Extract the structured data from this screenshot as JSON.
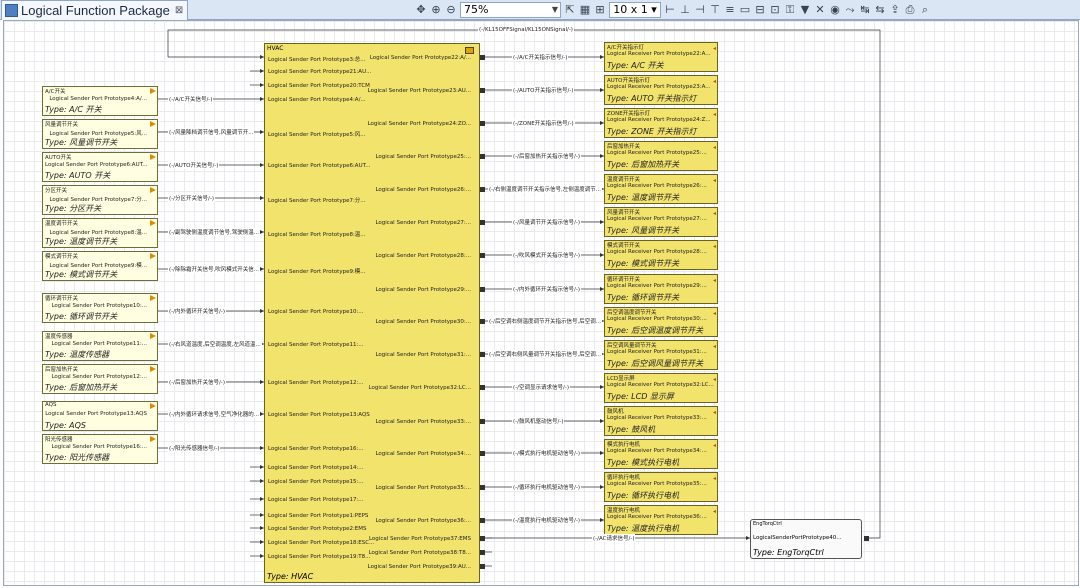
{
  "window": {
    "tab_title": "Logical Function Package"
  },
  "toolbar": {
    "zoom_value": "75%",
    "grid_value": "10 x 1"
  },
  "top_signal": "(-/KL15OFFSignal/KL15ONSignal/-)",
  "hvac": {
    "name": "HVAC",
    "type": "Type: HVAC",
    "left_ports": [
      "Logical Sender Port Prototype3:总...",
      "Logical Sender Port Prototype21:AU...",
      "Logical Sender Port Prototype20:TCM",
      "Logical Sender Port Prototype4:A/...",
      "Logical Sender Port Prototype5:风...",
      "Logical Sender Port Prototype6:AUT...",
      "Logical Sender Port Prototype7:分...",
      "Logical Sender Port Prototype8:温...",
      "Logical Sender Port Prototype9:模...",
      "Logical Sender Port Prototype10:...",
      "Logical Sender Port Prototype11:...",
      "Logical Sender Port Prototype12:...",
      "Logical Sender Port Prototype13:AQS",
      "Logical Sender Port Prototype16:...",
      "Logical Sender Port Prototype14:...",
      "Logical Sender Port Prototype15:...",
      "Logical Sender Port Prototype17:...",
      "Logical Sender Port Prototype1:PEPS",
      "Logical Sender Port Prototype2:EMS",
      "Logical Sender Port Prototype18:ESC...",
      "Logical Sender Port Prototype19:T8..."
    ],
    "right_ports": [
      "Logical Sender Port Prototype22:A/...",
      "Logical Sender Port Prototype23:AU...",
      "Logical Sender Port Prototype24:ZO...",
      "Logical Sender Port Prototype25:...",
      "Logical Sender Port Prototype26:...",
      "Logical Sender Port Prototype27:...",
      "Logical Sender Port Prototype28:...",
      "Logical Sender Port Prototype29:...",
      "Logical Sender Port Prototype30:...",
      "Logical Sender Port Prototype31:...",
      "Logical Sender Port Prototype32:LC...",
      "Logical Sender Port Prototype33:...",
      "Logical Sender Port Prototype34:...",
      "Logical Sender Port Prototype35:...",
      "Logical Sender Port Prototype36:...",
      "Logical Sender Port Prototype37:EMS",
      "Logical Sender Port Prototype38:T8...",
      "Logical Sender Port Prototype39:AU..."
    ]
  },
  "senders": [
    {
      "name": "A/C开关",
      "port": "Logical Sender Port Prototype4:A/...",
      "type": "Type: A/C 开关",
      "signal": "(-/A/C开关信号/-)"
    },
    {
      "name": "风量调节开关",
      "port": "Logical Sender Port Prototype5:风...",
      "type": "Type: 风量调节开关",
      "signal": "(-/风量降档调节信号,风量调节开..."
    },
    {
      "name": "AUTO开关",
      "port": "Logical Sender Port Prototype6:AUT...",
      "type": "Type: AUTO 开关",
      "signal": "(-/AUTO开关信号/-)"
    },
    {
      "name": "分区开关",
      "port": "Logical Sender Port Prototype7:分...",
      "type": "Type: 分区开关",
      "signal": "(-/分区开关信号/-)"
    },
    {
      "name": "温度调节开关",
      "port": "Logical Sender Port Prototype8:温...",
      "type": "Type: 温度调节开关",
      "signal": "(-/副驾驶侧温度调节信号,驾驶侧温..."
    },
    {
      "name": "模式调节开关",
      "port": "Logical Sender Port Prototype9:模...",
      "type": "Type: 模式调节开关",
      "signal": "(-/除除霜开关信号,吹风模式开关信..."
    },
    {
      "name": "循环调节开关",
      "port": "Logical Sender Port Prototype10:...",
      "type": "Type: 循环调节开关",
      "signal": "(-/内外循环开关信号/-)"
    },
    {
      "name": "温度传感器",
      "port": "Logical Sender Port Prototype11:...",
      "type": "Type: 温度传感器",
      "signal": "(-/右风道温度,后空调温度,左风道温..."
    },
    {
      "name": "后窗加热开关",
      "port": "Logical Sender Port Prototype12:...",
      "type": "Type: 后窗加热开关",
      "signal": "(-/后窗加热开关信号/-)"
    },
    {
      "name": "AQS",
      "port": "Logical Sender Port Prototype13:AQS",
      "type": "Type: AQS",
      "signal": "(-/内外循环请求信号,空气净化器的..."
    },
    {
      "name": "阳光传感器",
      "port": "Logical Sender Port Prototype16:...",
      "type": "Type: 阳光传感器",
      "signal": "(-/阳光传感器信号/-)"
    }
  ],
  "receivers": [
    {
      "name": "A/C开关指示灯",
      "port": "Logical Receiver Port Prototype22:A...",
      "type": "Type: A/C 开关",
      "signal": "(-/A/C开关指示信号/-)"
    },
    {
      "name": "AUTO开关指示灯",
      "port": "Logical Receiver Port Prototype23:A...",
      "type": "Type: AUTO 开关指示灯",
      "signal": "(-/AUTO开关指示信号/-)"
    },
    {
      "name": "ZONE开关指示灯",
      "port": "Logical Receiver Port Prototype24:Z...",
      "type": "Type: ZONE 开关指示灯",
      "signal": "(-/ZONE开关指示信号/-)"
    },
    {
      "name": "后窗加热开关",
      "port": "Logical Receiver Port Prototype25:...",
      "type": "Type: 后窗加热开关",
      "signal": "(-/后窗加热开关指示信号/-)"
    },
    {
      "name": "温度调节开关",
      "port": "Logical Receiver Port Prototype26:...",
      "type": "Type: 温度调节开关",
      "signal": "(-/右侧温度调节开关指示信号,左侧温度调节..."
    },
    {
      "name": "风量调节开关",
      "port": "Logical Receiver Port Prototype27:...",
      "type": "Type: 风量调节开关",
      "signal": "(-/风量调节开关指示信号/-)"
    },
    {
      "name": "模式调节开关",
      "port": "Logical Receiver Port Prototype28:...",
      "type": "Type: 模式调节开关",
      "signal": "(-/吹风模式开关指示信号/-)"
    },
    {
      "name": "循环调节开关",
      "port": "Logical Receiver Port Prototype29:...",
      "type": "Type: 循环调节开关",
      "signal": "(-/内外循环开关指示信号/-)"
    },
    {
      "name": "后空调温度调节开关",
      "port": "Logical Receiver Port Prototype30:...",
      "type": "Type: 后空调温度调节开关",
      "signal": "(-/后空调右侧温度调节开关指示信号,后空调..."
    },
    {
      "name": "后空调风量调节开关",
      "port": "Logical Receiver Port Prototype31:...",
      "type": "Type: 后空调风量调节开关",
      "signal": "(-/后空调右侧风量调节开关指示信号,后空调..."
    },
    {
      "name": "LCD显示屏",
      "port": "Logical Receiver Port Prototype32:LC...",
      "type": "Type: LCD 显示屏",
      "signal": "(-/空调显示请求信号/-)"
    },
    {
      "name": "鼓风机",
      "port": "Logical Receiver Port Prototype33:...",
      "type": "Type: 鼓风机",
      "signal": "(-/鼓风机驱动信号/-)"
    },
    {
      "name": "模式执行电机",
      "port": "Logical Receiver Port Prototype34:...",
      "type": "Type: 模式执行电机",
      "signal": "(-/模式执行电机驱动信号/-)"
    },
    {
      "name": "循环执行电机",
      "port": "Logical Receiver Port Prototype35:...",
      "type": "Type: 循环执行电机",
      "signal": "(-/循环执行电机驱动信号/-)"
    },
    {
      "name": "温度执行电机",
      "port": "Logical Receiver Port Prototype36:...",
      "type": "Type: 温度执行电机",
      "signal": "(-/温度执行电机驱动信号/-)"
    }
  ],
  "eng": {
    "name": "EngTorqCtrl",
    "port": "LogicalSenderPortPrototype40...",
    "type": "Type: EngTorqCtrl",
    "signal": "(-/AC请求信号/-)"
  },
  "colors": {
    "receiver_fill": "#f2e36d",
    "sender_fill": "#fffee0",
    "port_arrow": "#dc8a00"
  }
}
